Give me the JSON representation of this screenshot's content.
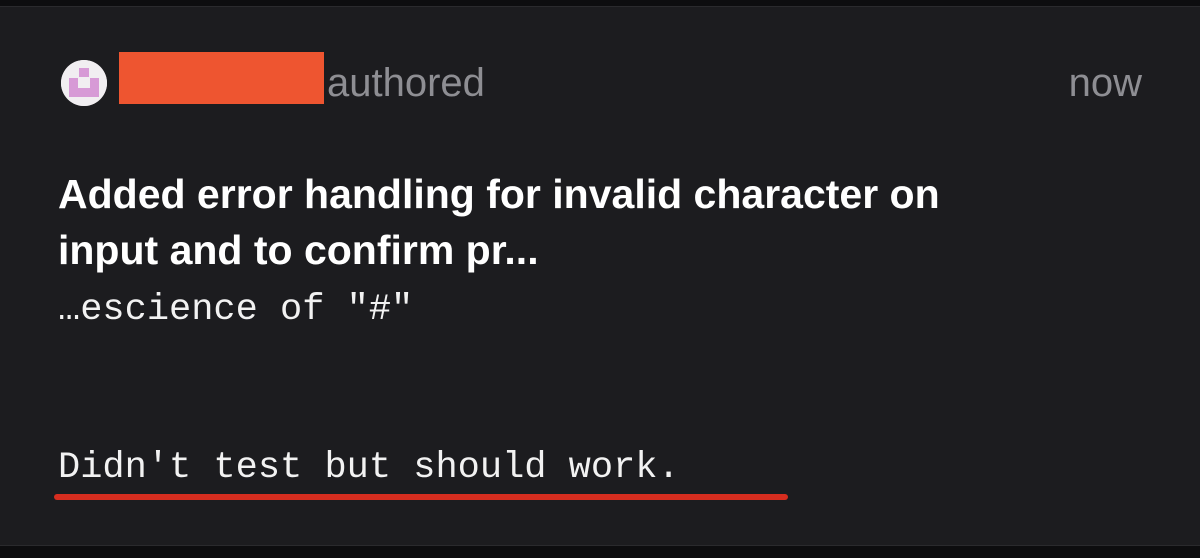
{
  "commit": {
    "author_suffix": "authored",
    "time": "now",
    "title_lines": [
      "Added error handling for invalid character on",
      "input and to confirm pr..."
    ],
    "title_continuation": "…escience of \"#\"",
    "body": "Didn't test but should work."
  },
  "colors": {
    "background": "#1c1c1f",
    "redaction": "#ee5530",
    "underline": "#d62d1f",
    "muted_text": "#8e8e93"
  },
  "icons": {
    "avatar": "pixel-identicon-avatar"
  }
}
